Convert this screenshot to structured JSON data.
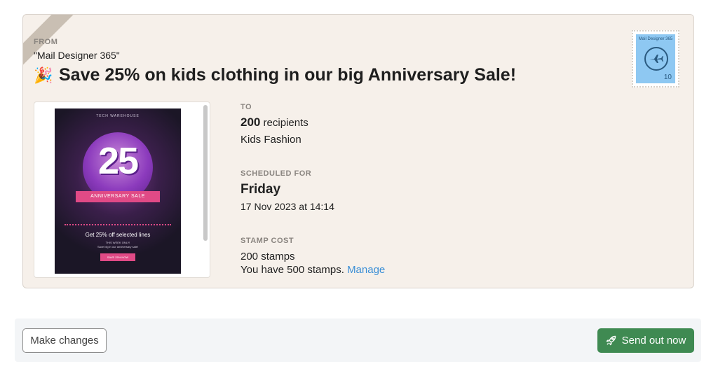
{
  "envelope": {
    "from_label": "FROM",
    "from_value": "\"Mail Designer 365\"",
    "subject_icon": "party-popper-icon",
    "subject_icon_glyph": "🎉",
    "subject": "Save 25% on kids clothing in our big Anniversary Sale!",
    "stamp": {
      "text": "Mail Designer 365",
      "icon": "airplane-icon",
      "value": "10",
      "color": "#8ec8f2"
    },
    "preview": {
      "brand": "TECH WAREHOUSE",
      "headline_number": "25",
      "ribbon": "ANNIVERSARY SALE",
      "line1": "Get 25% off selected lines",
      "line2": "THIS WEEK ONLY!",
      "line3": "Save big in our anniversary sale!",
      "button": "SAVE 25% NOW"
    },
    "to": {
      "label": "TO",
      "count": "200",
      "count_suffix": " recipients",
      "list": "Kids Fashion"
    },
    "schedule": {
      "label": "SCHEDULED FOR",
      "day": "Friday",
      "date": "17 Nov 2023 at 14:14"
    },
    "cost": {
      "label": "STAMP COST",
      "value": "200 stamps",
      "balance": "You have 500 stamps. ",
      "manage": "Manage"
    }
  },
  "footer": {
    "make_changes": "Make changes",
    "send_now": "Send out now",
    "send_icon": "rocket-icon",
    "send_color": "#3f8a52"
  }
}
